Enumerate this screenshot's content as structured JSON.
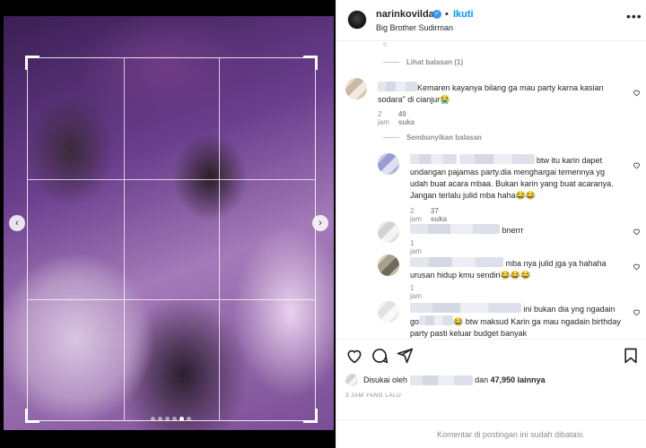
{
  "header": {
    "username": "narinkovilda",
    "follow_label": "Ikuti",
    "location": "Big Brother Sudirman",
    "more_label": "•••",
    "sep": "•"
  },
  "media": {
    "prev_arrow": "‹",
    "next_arrow": "›",
    "dots_count": 6,
    "active_dot": 4
  },
  "comments": {
    "top_fragment": "5",
    "view_replies": "Lihat balasan (1)",
    "hide_replies": "Sembunyikan balasan",
    "items": [
      {
        "text": "Kemaren kayanya bilang ga mau party karna kasian sodara\" di cianjur😭",
        "time": "2 jam",
        "likes": "49 suka"
      },
      {
        "text": "btw itu karin dapet undangan pajamas party.dia menghargai temennya yg udah buat acara mbaa. Bukan karin yang buat acaranya. Jangan terlalu julid mba haha😂😂",
        "time": "2 jam",
        "likes": "37 suka"
      },
      {
        "text": "bnerrr",
        "time": "1 jam"
      },
      {
        "text": "mba nya julid jga ya hahaha urusan hidup kmu sendiri😂😂😂",
        "time": "1 jam"
      },
      {
        "text": "ini bukan dia yng ngadain go",
        "text_b": "😂 btw maksud Karin ga mau ngadain birthday party pasti keluar budget banyak"
      }
    ]
  },
  "footer_info": {
    "liked_prefix": "Disukai oleh",
    "liked_joiner": "dan",
    "liked_count": "47,950 lainnya",
    "timestamp": "3 JAM YANG LALU",
    "comments_disabled": "Komentar di postingan ini sudah dibatasi."
  },
  "icons": [
    "heart-icon",
    "comment-icon",
    "share-icon",
    "bookmark-icon",
    "verified-icon",
    "more-icon"
  ],
  "colors": {
    "accent": "#0095f6",
    "verified": "#3897f0",
    "text": "#262626",
    "muted": "#8e8e8e"
  }
}
